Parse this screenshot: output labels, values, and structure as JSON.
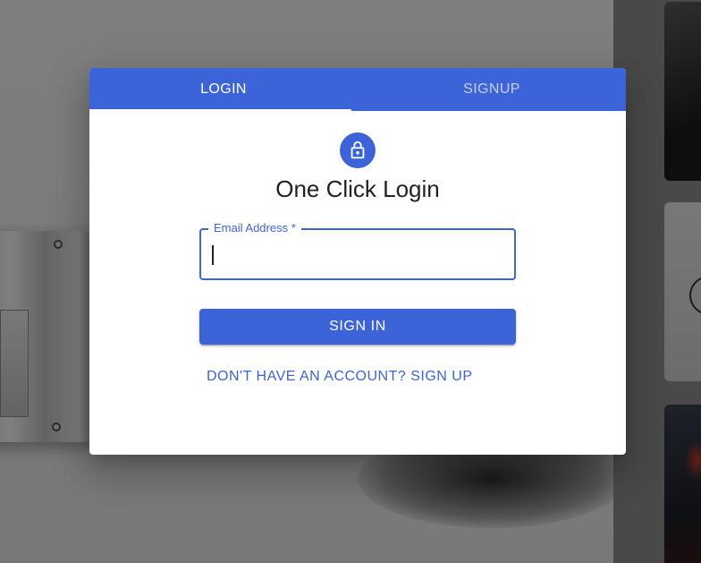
{
  "colors": {
    "primary": "#3d63d8",
    "dialog_bg": "#ffffff",
    "title_text": "#222222"
  },
  "tabs": [
    {
      "label": "LOGIN",
      "active": true
    },
    {
      "label": "SIGNUP",
      "active": false
    }
  ],
  "header": {
    "icon": "lock-icon",
    "title": "One Click Login"
  },
  "email_field": {
    "label": "Email Address *",
    "value": "",
    "placeholder": ""
  },
  "actions": {
    "sign_in_label": "SIGN IN",
    "signup_link_label": "DON'T HAVE AN ACCOUNT? SIGN UP"
  }
}
